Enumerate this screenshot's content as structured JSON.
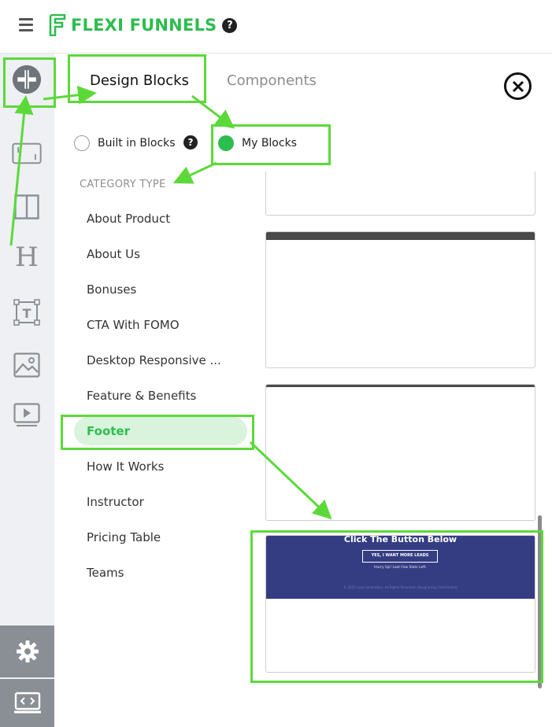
{
  "header": {
    "logo_text": "FLEXI FUNNELS",
    "help_glyph": "?"
  },
  "tabs": [
    {
      "label": "Design Blocks",
      "active": true
    },
    {
      "label": "Components",
      "active": false
    }
  ],
  "block_source": {
    "options": [
      {
        "label": "Built in Blocks",
        "selected": false
      },
      {
        "label": "My Blocks",
        "selected": true
      }
    ]
  },
  "categories": {
    "heading": "CATEGORY TYPE",
    "items": [
      "About Product",
      "About Us",
      "Bonuses",
      "CTA With FOMO",
      "Desktop Responsive ...",
      "Feature & Benefits",
      "Footer",
      "How It Works",
      "Instructor",
      "Pricing Table",
      "Teams"
    ],
    "active_index": 6
  },
  "preview": {
    "footer_headline": "Click The Button Below",
    "footer_button": "YES, I WANT MORE LEADS",
    "footer_note": "Hurry Up! Last Few Slots Left.",
    "footer_copyright": "© 2021 Lead Generation. All Rights Reserved. Designed by FlexiFunnels"
  },
  "rail_icons": [
    "add-block-icon",
    "section-icon",
    "columns-icon",
    "heading-icon",
    "text-icon",
    "image-icon",
    "video-icon",
    "settings-icon",
    "code-icon"
  ],
  "colors": {
    "brand_green": "#2dbd4e",
    "annotation_green": "#5cd93a",
    "active_category_bg": "#d9f3dd",
    "footer_preview_bg": "#343d82"
  }
}
